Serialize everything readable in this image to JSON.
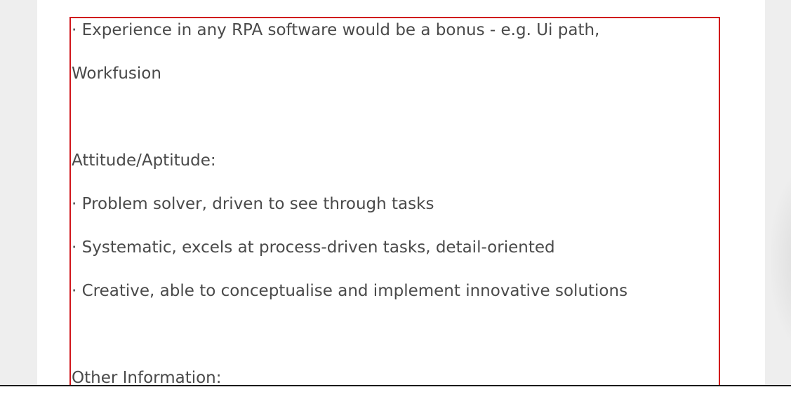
{
  "job_description": {
    "lines": [
      "· Experience in any RPA software would be a bonus - e.g. Ui path,",
      "Workfusion",
      "Attitude/Aptitude:",
      "· Problem solver, driven to see through tasks",
      "· Systematic, excels at process-driven tasks, detail-oriented",
      "· Creative, able to conceptualise and implement innovative solutions",
      "Other Information:"
    ]
  },
  "colors": {
    "page_background": "#eeeeee",
    "content_background": "#ffffff",
    "text": "#4a4a4a",
    "highlight_border": "#d0151b"
  }
}
